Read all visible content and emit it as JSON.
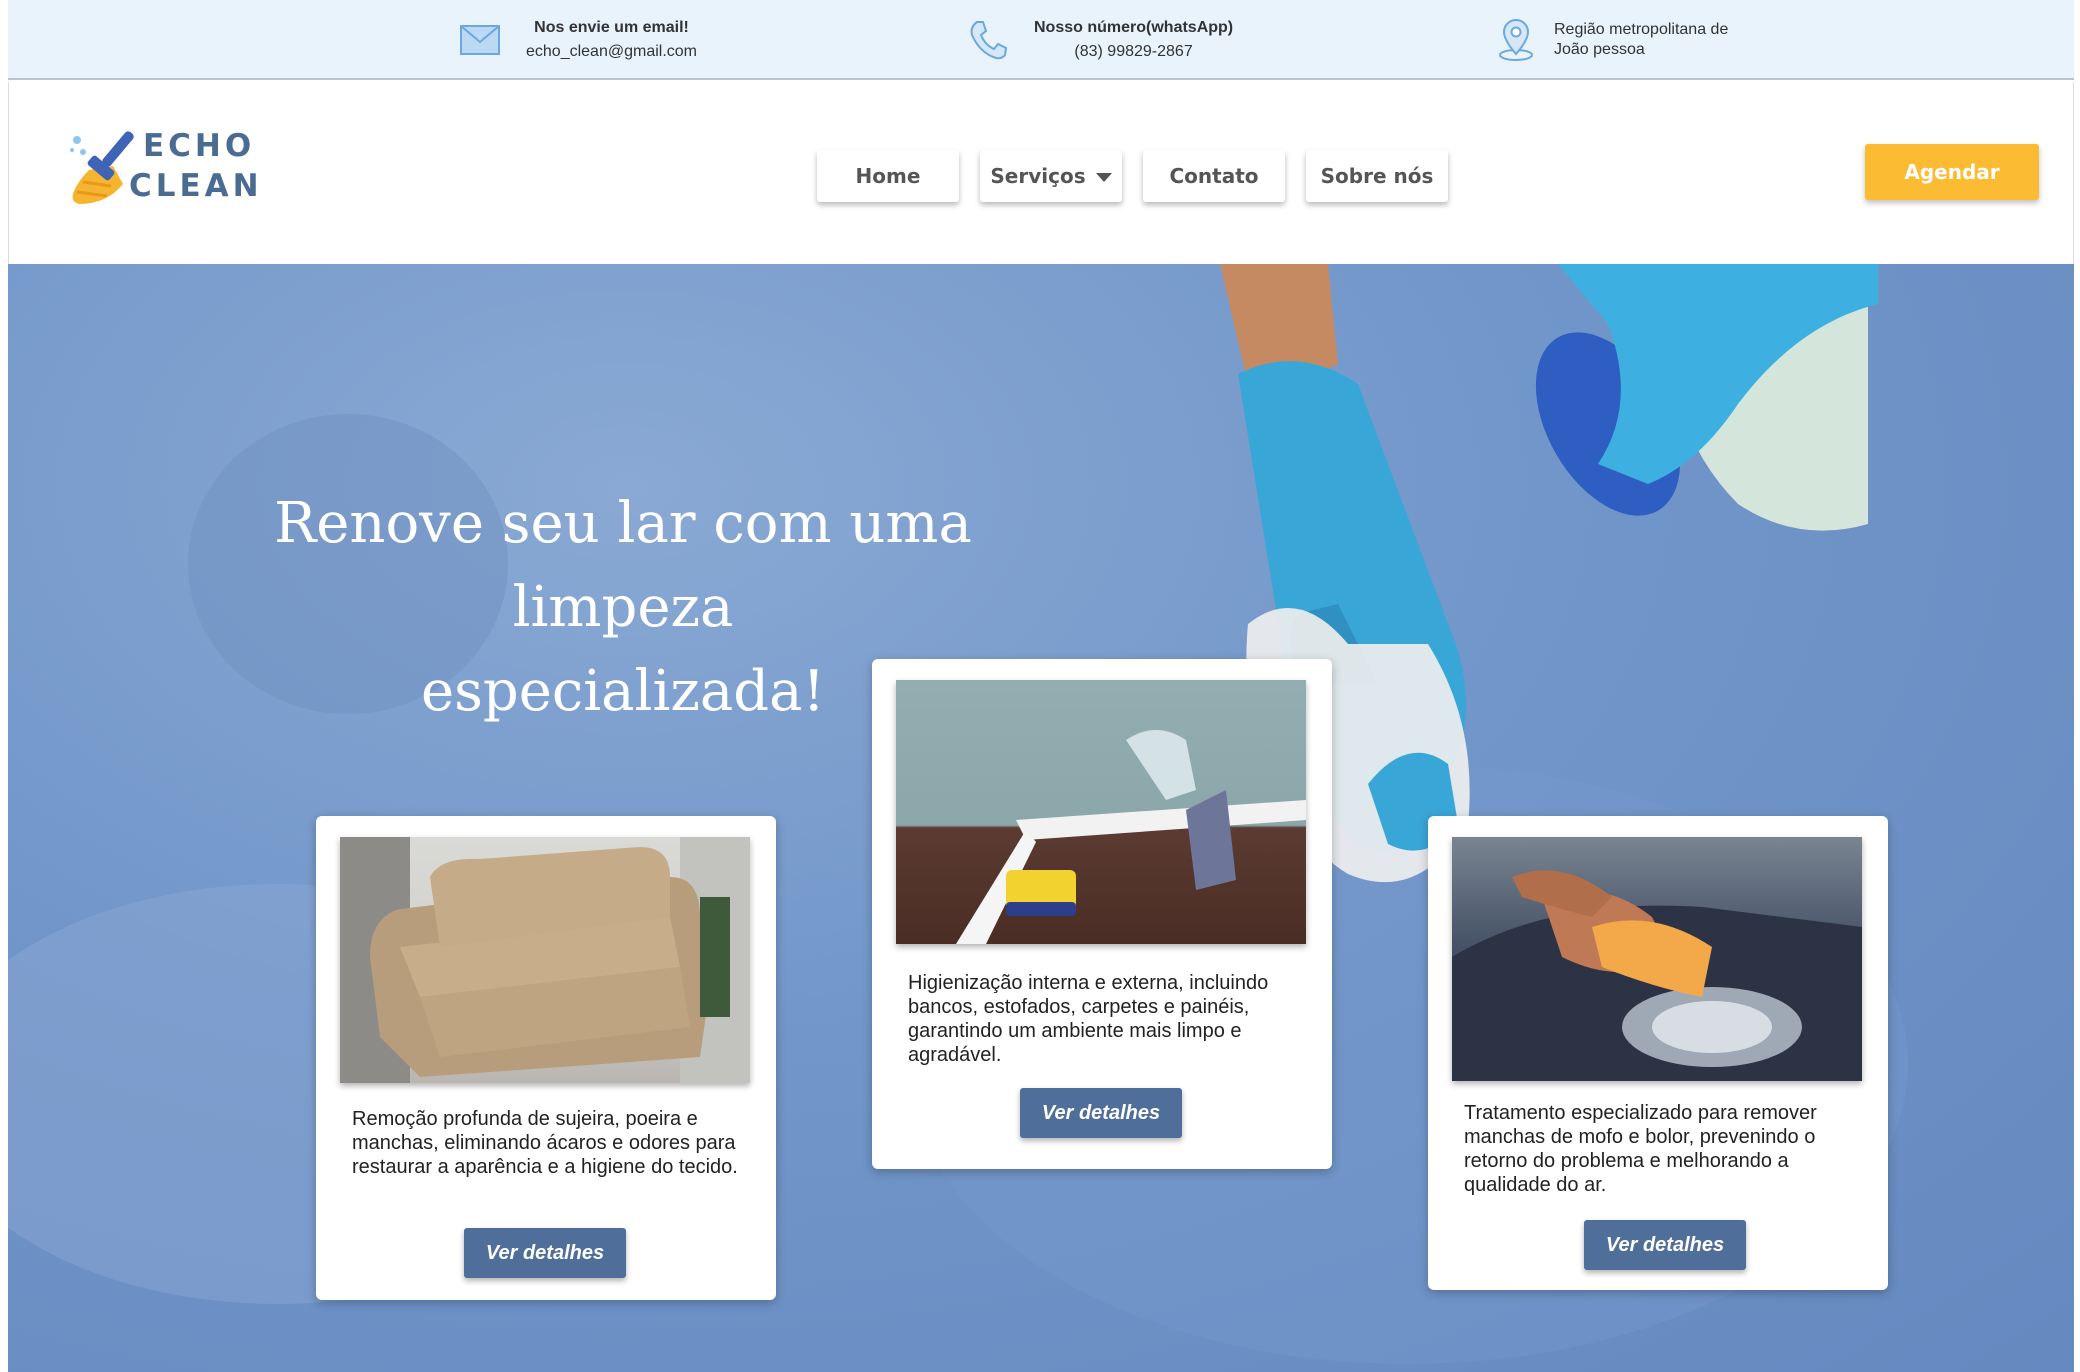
{
  "topbar": {
    "email": {
      "title": "Nos envie um email!",
      "value": "echo_clean@gmail.com"
    },
    "phone": {
      "title": "Nosso número(whatsApp)",
      "value": "(83) 99829-2867"
    },
    "address": {
      "line1": "Região metropolitana de",
      "line2": "João pessoa"
    }
  },
  "header": {
    "logo": {
      "line1": "ECHO",
      "line2": "CLEAN"
    },
    "nav": [
      {
        "label": "Home"
      },
      {
        "label": "Serviços"
      },
      {
        "label": "Contato"
      },
      {
        "label": "Sobre nós"
      }
    ],
    "cta_label": "Agendar"
  },
  "hero": {
    "title_line1": "Renove seu lar com uma limpeza",
    "title_line2": "especializada!"
  },
  "cards": [
    {
      "description": "Remoção profunda de sujeira, poeira e manchas, eliminando ácaros e odores para restaurar a aparência e a higiene do tecido.",
      "button_label": "Ver detalhes"
    },
    {
      "description": "Higienização interna e externa, incluindo bancos, estofados, carpetes e painéis, garantindo um ambiente mais limpo e agradável.",
      "button_label": "Ver detalhes"
    },
    {
      "description": "Tratamento especializado para remover manchas de mofo e bolor, prevenindo o retorno do problema e melhorando a qualidade do ar.",
      "button_label": "Ver detalhes"
    }
  ],
  "colors": {
    "topbar_bg": "#e8f3fc",
    "brand": "#4a6c93",
    "cta": "#fbbb32",
    "button": "#4f6f9a",
    "hero": "#7196c9"
  },
  "icons": [
    "envelope-icon",
    "phone-icon",
    "location-pin-icon",
    "broom-icon",
    "chevron-down-icon"
  ]
}
